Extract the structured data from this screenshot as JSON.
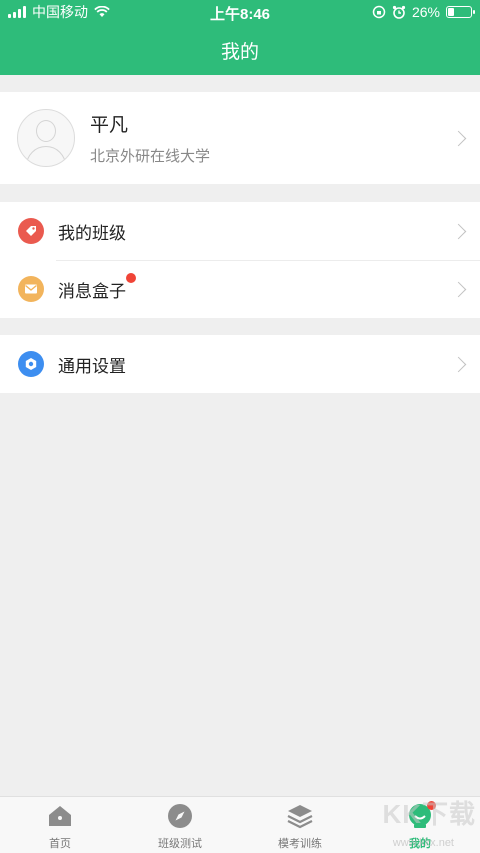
{
  "status_bar": {
    "carrier": "中国移动",
    "time": "上午8:46",
    "battery": "26%"
  },
  "header": {
    "title": "我的"
  },
  "profile": {
    "name": "平凡",
    "school": "北京外研在线大学"
  },
  "menu": [
    {
      "label": "我的班级",
      "icon": "tag-icon",
      "color": "#ea5a4f"
    },
    {
      "label": "消息盒子",
      "icon": "mail-icon",
      "color": "#f2b45c",
      "badge": true
    },
    {
      "label": "通用设置",
      "icon": "settings-icon",
      "color": "#3d8ef0"
    }
  ],
  "tabs": [
    {
      "label": "首页",
      "icon": "home-icon"
    },
    {
      "label": "班级测试",
      "icon": "compass-icon"
    },
    {
      "label": "模考训练",
      "icon": "layers-icon"
    },
    {
      "label": "我的",
      "icon": "profile-icon",
      "active": true
    }
  ],
  "colors": {
    "brand": "#2ebc7a",
    "badge": "#f04437"
  },
  "watermark": {
    "text": "KK下载",
    "sub": "www.kkx.net"
  }
}
